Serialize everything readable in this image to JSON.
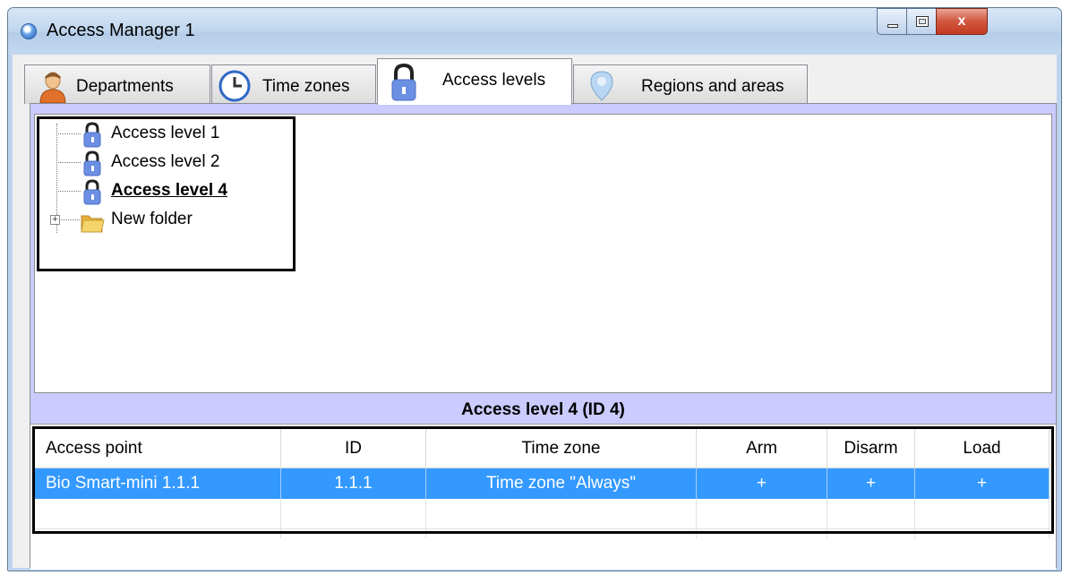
{
  "window": {
    "title": "Access Manager 1",
    "controls": {
      "close_glyph": "x"
    }
  },
  "tabs": [
    {
      "label": "Departments",
      "icon": "person-icon",
      "active": false
    },
    {
      "label": "Time zones",
      "icon": "clock-icon",
      "active": false
    },
    {
      "label": "Access levels",
      "icon": "lock-icon",
      "active": true
    },
    {
      "label": "Regions and areas",
      "icon": "map-pin-icon",
      "active": false
    }
  ],
  "tree": {
    "items": [
      {
        "label": "Access level 1",
        "icon": "lock-icon",
        "selected": false
      },
      {
        "label": "Access level 2",
        "icon": "lock-icon",
        "selected": false
      },
      {
        "label": "Access level 4",
        "icon": "lock-icon",
        "selected": true
      },
      {
        "label": "New folder",
        "icon": "folder-icon",
        "expandable": true,
        "expand_glyph": "+"
      }
    ]
  },
  "detail": {
    "title": "Access level 4 (ID 4)"
  },
  "grid": {
    "columns": [
      "Access point",
      "ID",
      "Time zone",
      "Arm",
      "Disarm",
      "Load"
    ],
    "rows": [
      {
        "access_point": "Bio Smart-mini 1.1.1",
        "id": "1.1.1",
        "time_zone": "Time zone \"Always\"",
        "arm": "+",
        "disarm": "+",
        "load": "+",
        "selected": true
      }
    ]
  },
  "colors": {
    "panel_bg": "#cbcbff",
    "selection": "#3399ff",
    "lock_blue": "#6b8fe3",
    "folder_yellow": "#f5c842"
  }
}
